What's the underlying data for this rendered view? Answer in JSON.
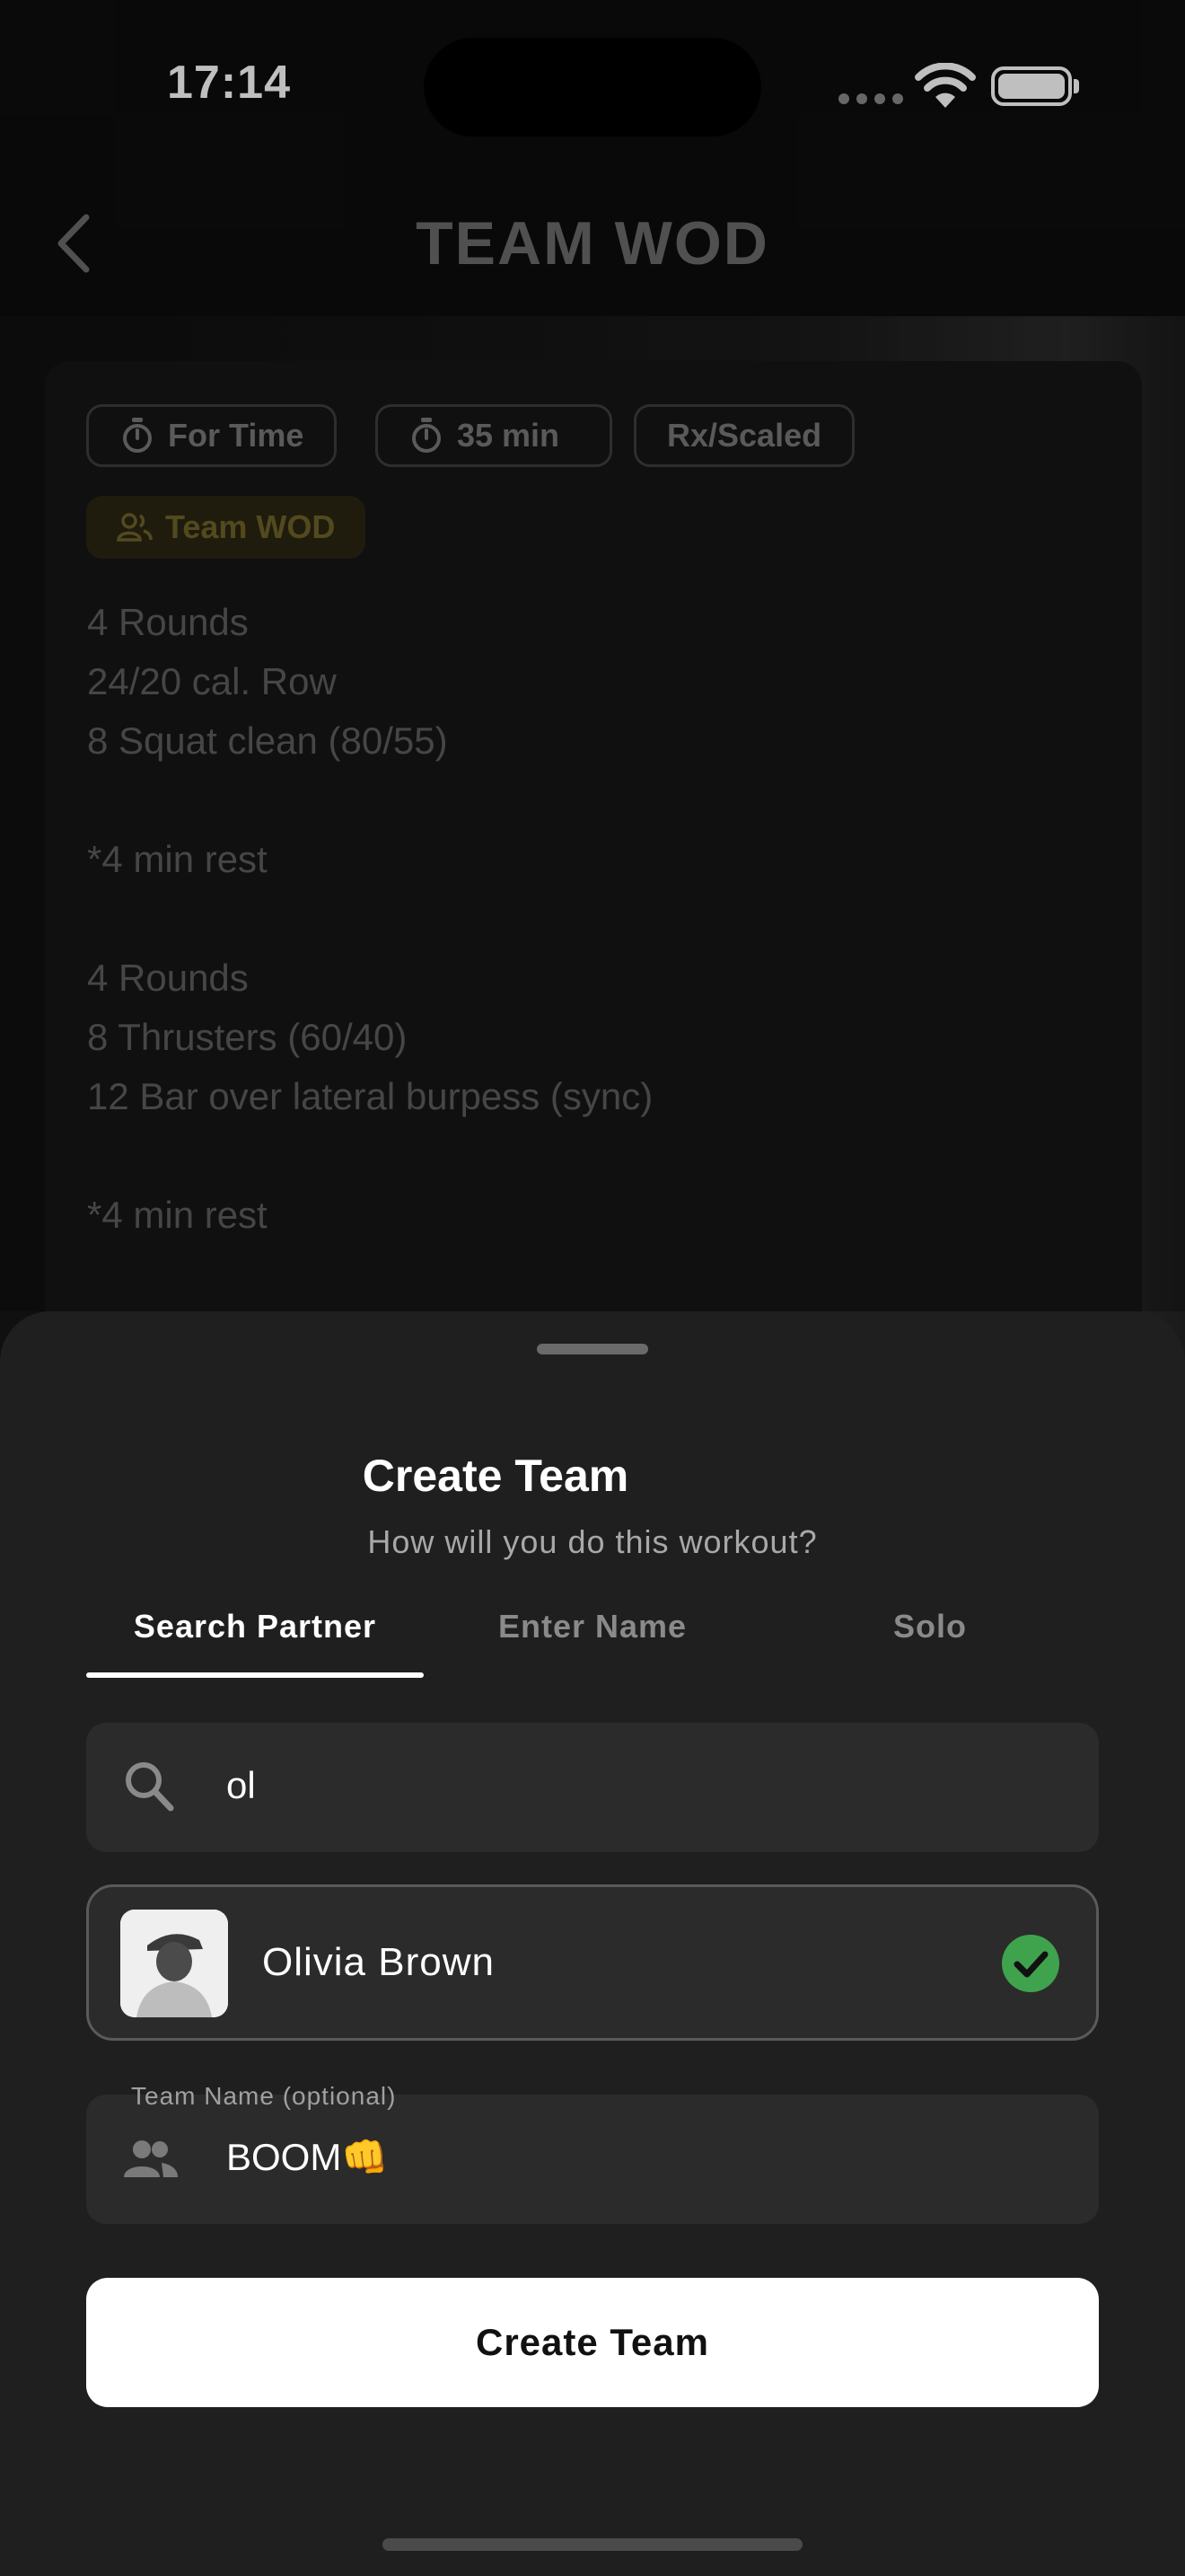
{
  "status_bar": {
    "time": "17:14"
  },
  "header": {
    "title": "TEAM WOD"
  },
  "wod": {
    "tags": [
      {
        "label": "For Time",
        "icon": "stopwatch-icon"
      },
      {
        "label": "35 min",
        "icon": "stopwatch-icon"
      },
      {
        "label": "Rx/Scaled"
      }
    ],
    "team_tag": {
      "label": "Team WOD",
      "icon": "group-icon",
      "color": "#6e6329"
    },
    "description": "4 Rounds\n24/20 cal. Row\n8 Squat clean (80/55)\n\n*4 min rest\n\n4 Rounds\n8 Thrusters (60/40)\n12 Bar over lateral burpess (sync)\n\n*4 min rest"
  },
  "sheet": {
    "title": "Create Team",
    "subtitle": "How will you do this workout?",
    "tabs": [
      {
        "label": "Search Partner",
        "active": true
      },
      {
        "label": "Enter Name",
        "active": false
      },
      {
        "label": "Solo",
        "active": false
      }
    ],
    "search": {
      "value": "ol",
      "icon": "search-icon"
    },
    "partner": {
      "name": "Olivia Brown",
      "selected": true,
      "check_color": "#3fa34d"
    },
    "team_name": {
      "label": "Team Name (optional)",
      "value": "BOOM👊",
      "icon": "group-icon"
    },
    "cta_label": "Create Team"
  }
}
